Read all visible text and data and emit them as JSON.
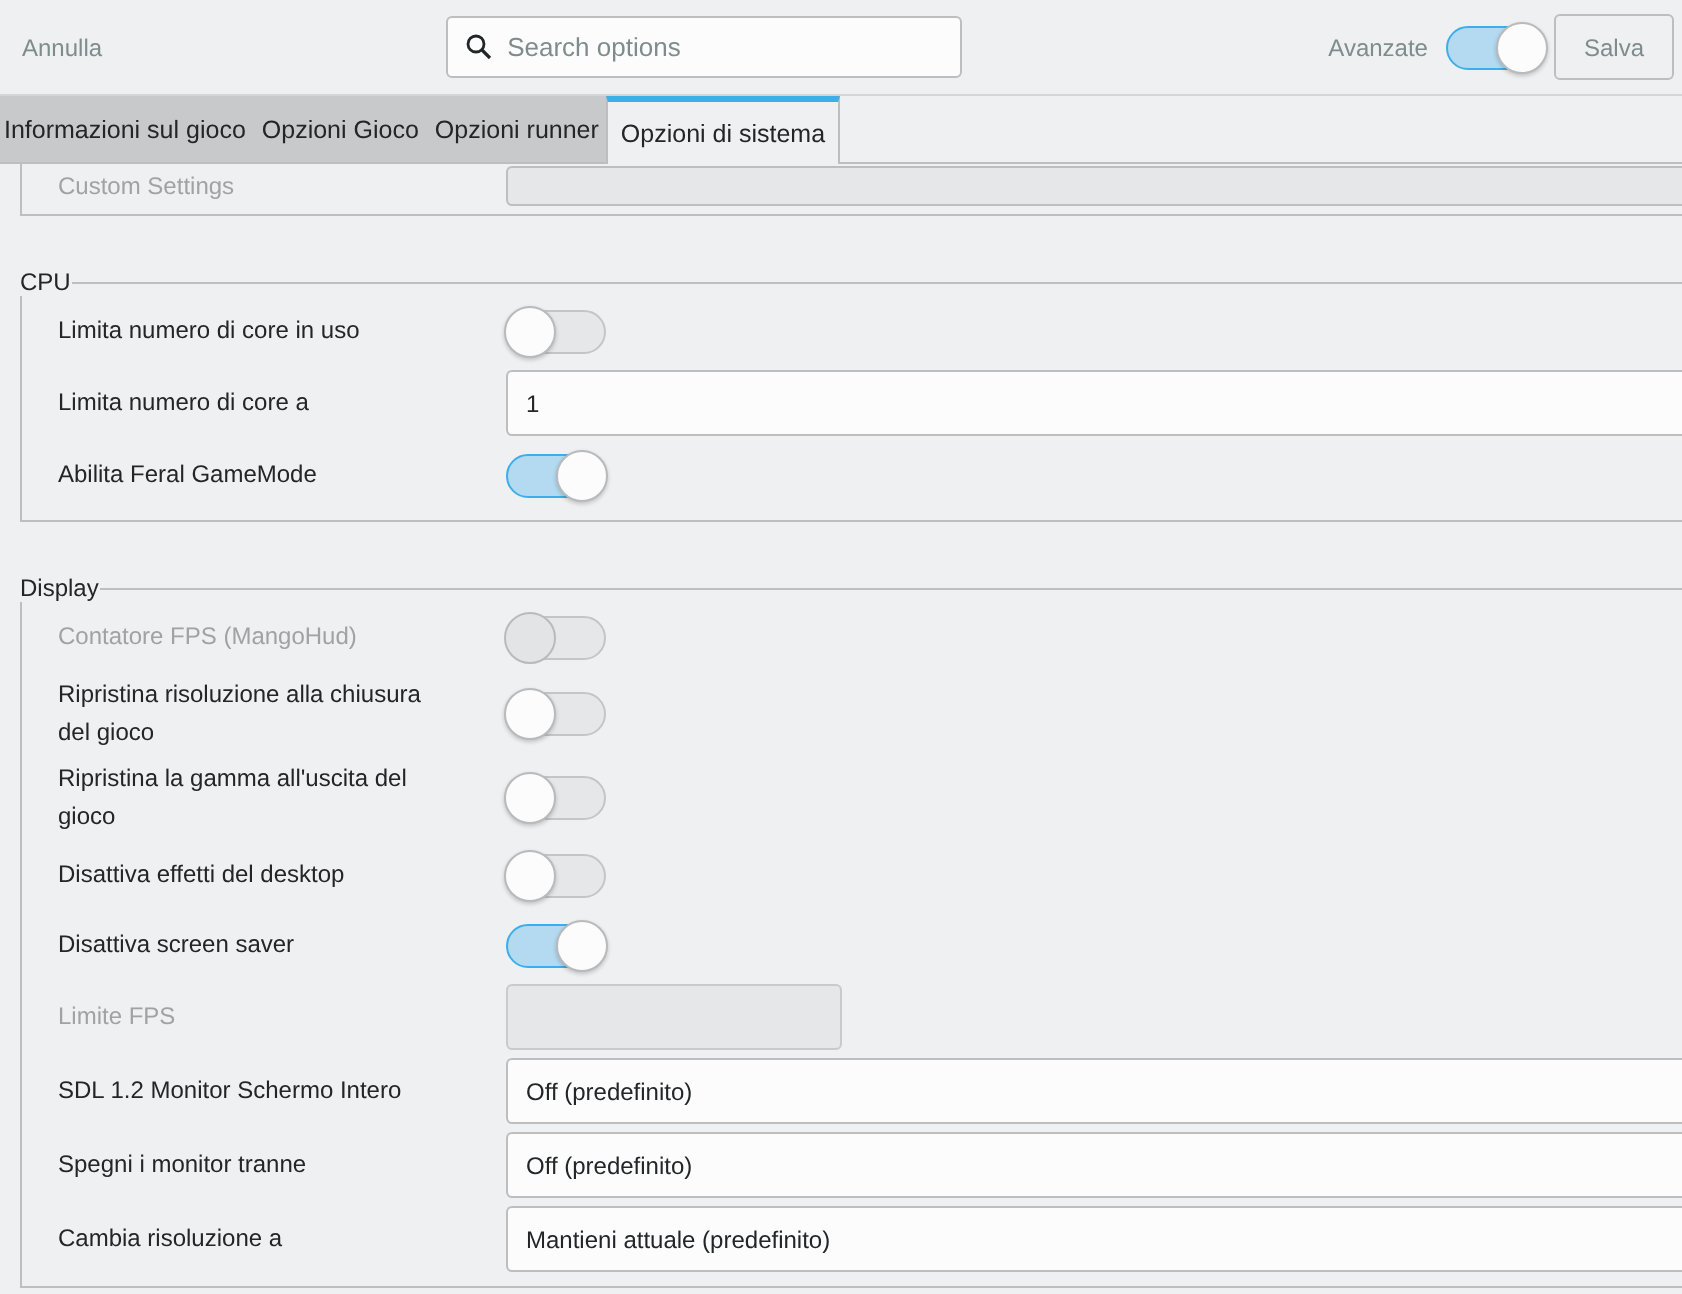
{
  "header": {
    "cancel": "Annulla",
    "search": {
      "placeholder": "Search options"
    },
    "advanced": {
      "label": "Avanzate",
      "on": true
    },
    "save": "Salva"
  },
  "tabs": [
    {
      "label": "Informazioni sul gioco",
      "selected": false
    },
    {
      "label": "Opzioni Gioco",
      "selected": false
    },
    {
      "label": "Opzioni runner",
      "selected": false
    },
    {
      "label": "Opzioni di sistema",
      "selected": true
    }
  ],
  "sections": [
    {
      "rows": [
        {
          "label": "Custom Settings",
          "kind": "entry",
          "disabled": true
        }
      ]
    },
    {
      "title": "CPU",
      "rows": [
        {
          "label": "Limita numero di core in uso",
          "kind": "toggle",
          "on": false,
          "disabled": false
        },
        {
          "label": "Limita numero di core a",
          "kind": "entry",
          "value": "1",
          "disabled": false
        },
        {
          "label": "Abilita Feral GameMode",
          "kind": "toggle",
          "on": true,
          "disabled": false
        }
      ]
    },
    {
      "title": "Display",
      "rows": [
        {
          "label": "Contatore FPS (MangoHud)",
          "kind": "toggle",
          "on": false,
          "disabled": true
        },
        {
          "label": "Ripristina risoluzione alla chiusura del gioco",
          "kind": "toggle",
          "on": false,
          "disabled": false
        },
        {
          "label": "Ripristina la gamma all'uscita del gioco",
          "kind": "toggle",
          "on": false,
          "disabled": false
        },
        {
          "label": "Disattiva effetti del desktop",
          "kind": "toggle",
          "on": false,
          "disabled": false
        },
        {
          "label": "Disattiva screen saver",
          "kind": "toggle",
          "on": true,
          "disabled": false
        },
        {
          "label": "Limite FPS",
          "kind": "small-entry",
          "disabled": true
        },
        {
          "label": "SDL 1.2 Monitor Schermo Intero",
          "kind": "entry",
          "value": "Off (predefinito)",
          "disabled": false
        },
        {
          "label": "Spegni i monitor tranne",
          "kind": "entry",
          "value": "Off (predefinito)",
          "disabled": false
        },
        {
          "label": "Cambia risoluzione a",
          "kind": "entry",
          "value": "Mantieni attuale (predefinito)",
          "disabled": false
        }
      ]
    }
  ]
}
